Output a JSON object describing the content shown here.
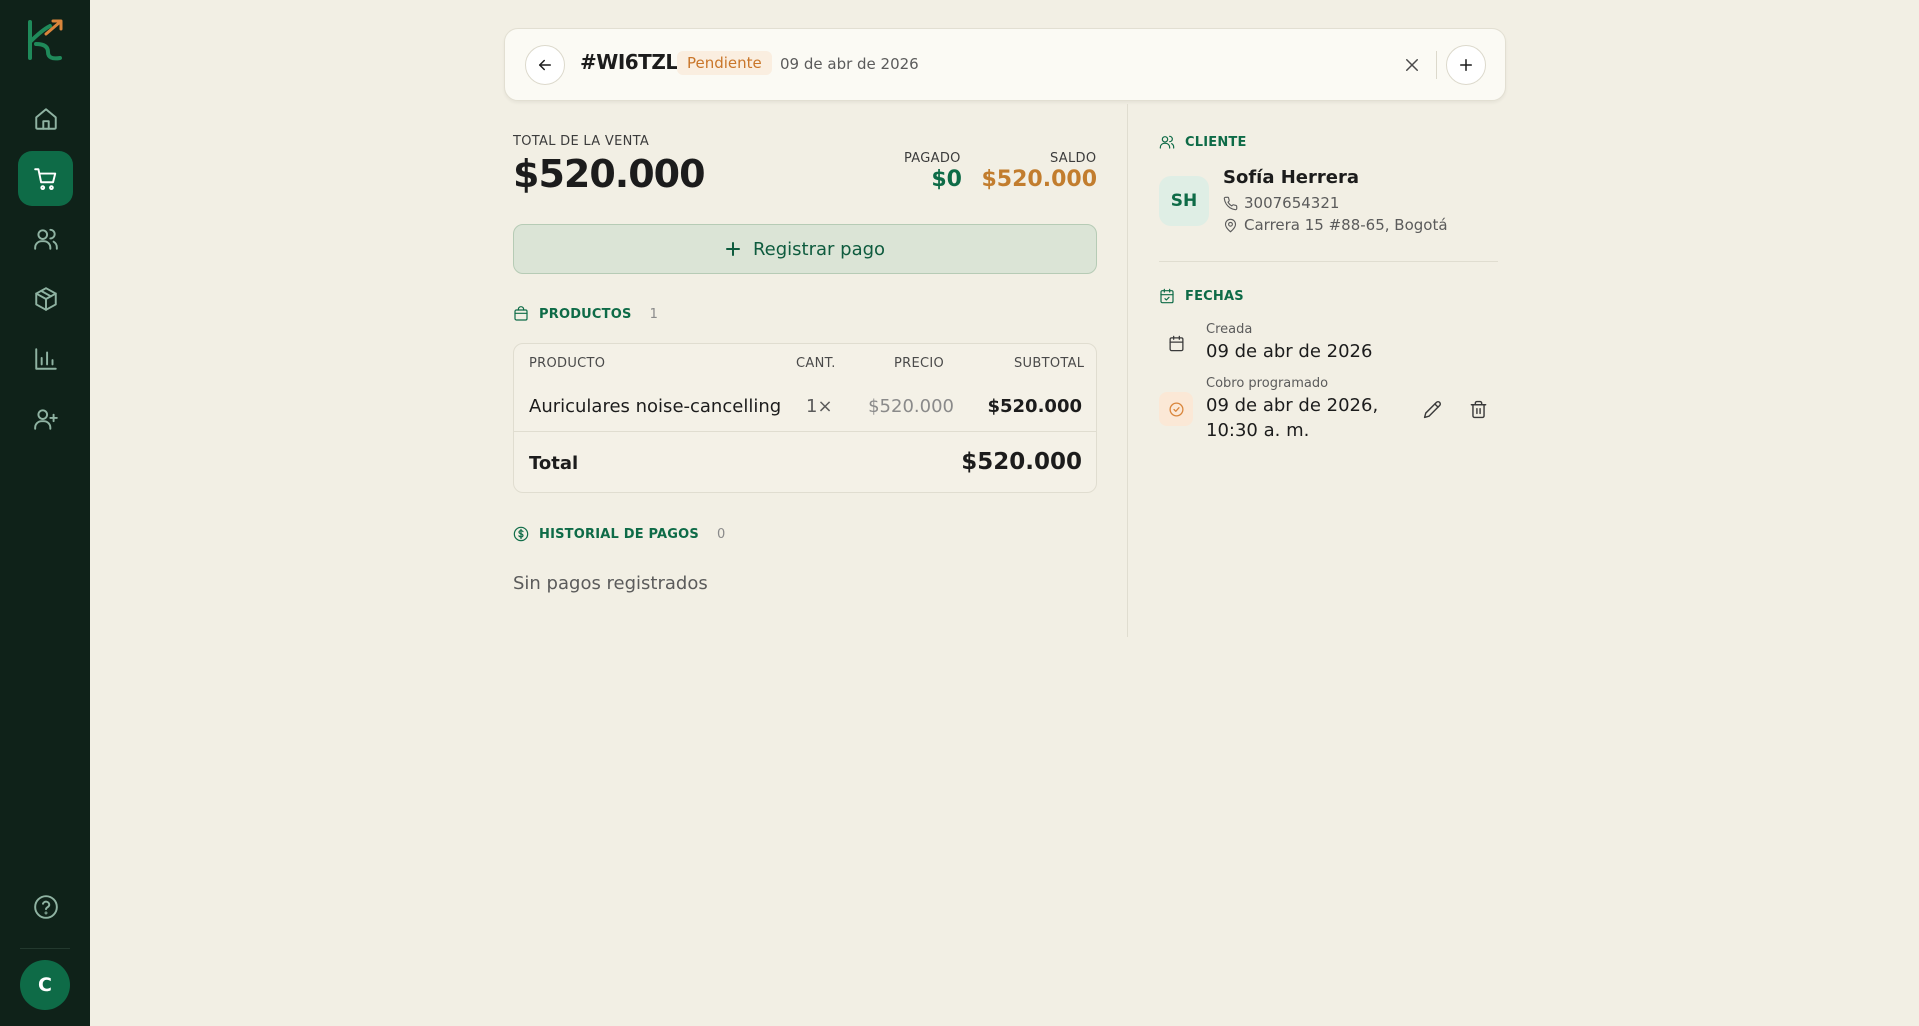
{
  "sidebar": {
    "items": [
      {
        "name": "home-icon"
      },
      {
        "name": "cart-icon",
        "active": true
      },
      {
        "name": "users-icon"
      },
      {
        "name": "box-icon"
      },
      {
        "name": "chart-icon"
      },
      {
        "name": "user-plus-icon"
      }
    ],
    "help_icon": "help-icon",
    "user_initial": "C"
  },
  "header": {
    "order_id": "#WI6TZL",
    "status": "Pendiente",
    "date": "09 de abr de 2026"
  },
  "summary": {
    "total_label": "TOTAL DE LA VENTA",
    "total": "$520.000",
    "paid_label": "PAGADO",
    "paid": "$0",
    "balance_label": "SALDO",
    "balance": "$520.000",
    "register_payment": "Registrar pago"
  },
  "products": {
    "title": "PRODUCTOS",
    "count": "1",
    "headers": {
      "product": "PRODUCTO",
      "qty": "CANT.",
      "price": "PRECIO",
      "subtotal": "SUBTOTAL"
    },
    "rows": [
      {
        "product": "Auriculares noise-cancelling",
        "qty": "1×",
        "price": "$520.000",
        "subtotal": "$520.000"
      }
    ],
    "total_label": "Total",
    "total": "$520.000"
  },
  "payments": {
    "title": "HISTORIAL DE PAGOS",
    "count": "0",
    "empty": "Sin pagos registrados"
  },
  "client": {
    "title": "CLIENTE",
    "initials": "SH",
    "name": "Sofía Herrera",
    "phone": "3007654321",
    "address": "Carrera 15 #88-65, Bogotá"
  },
  "dates": {
    "title": "FECHAS",
    "created_label": "Creada",
    "created": "09 de abr de 2026",
    "scheduled_label": "Cobro programado",
    "scheduled_line1": "09 de abr de 2026,",
    "scheduled_line2": "10:30 a. m."
  },
  "colors": {
    "sidebar": "#0f2219",
    "accent": "#0e6b47",
    "warning": "#c27d2e",
    "background": "#f2efe4"
  }
}
